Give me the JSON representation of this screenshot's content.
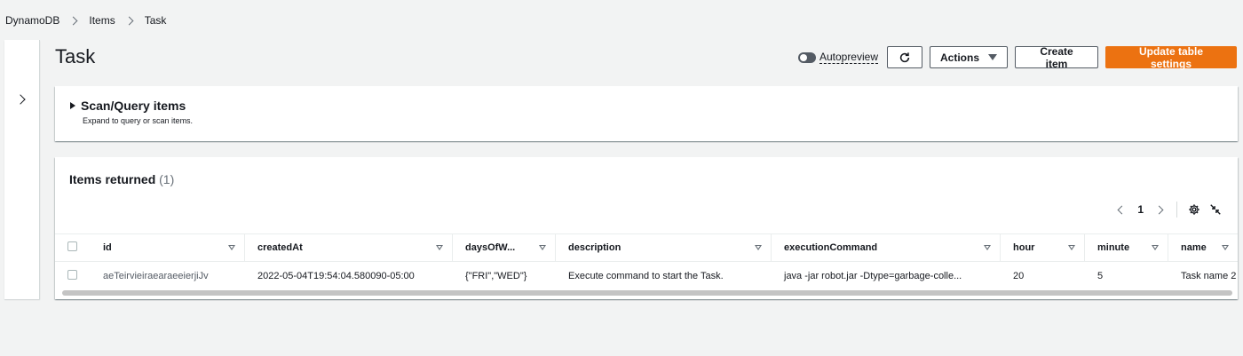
{
  "breadcrumb": {
    "items": [
      "DynamoDB",
      "Items",
      "Task"
    ]
  },
  "page": {
    "title": "Task"
  },
  "toolbar": {
    "autopreview_label": "Autopreview",
    "actions_label": "Actions",
    "create_label": "Create item",
    "update_label": "Update table settings"
  },
  "scan": {
    "title": "Scan/Query items",
    "description": "Expand to query or scan items."
  },
  "items": {
    "title": "Items returned",
    "count": "(1)",
    "page_number": "1",
    "columns": [
      "id",
      "createdAt",
      "daysOfW...",
      "description",
      "executionCommand",
      "hour",
      "minute",
      "name"
    ],
    "rows": [
      {
        "id": "aeTeirvieiraearaeeierjiJv",
        "createdAt": "2022-05-04T19:54:04.580090-05:00",
        "daysOfWeek": "{\"FRI\",\"WED\"}",
        "description": "Execute command to start the Task.",
        "executionCommand": "java -jar robot.jar -Dtype=garbage-colle...",
        "hour": "20",
        "minute": "5",
        "name": "Task name 2"
      }
    ]
  },
  "colors": {
    "primary": "#ec7211",
    "background": "#f2f3f3",
    "link": "#0073bb"
  }
}
